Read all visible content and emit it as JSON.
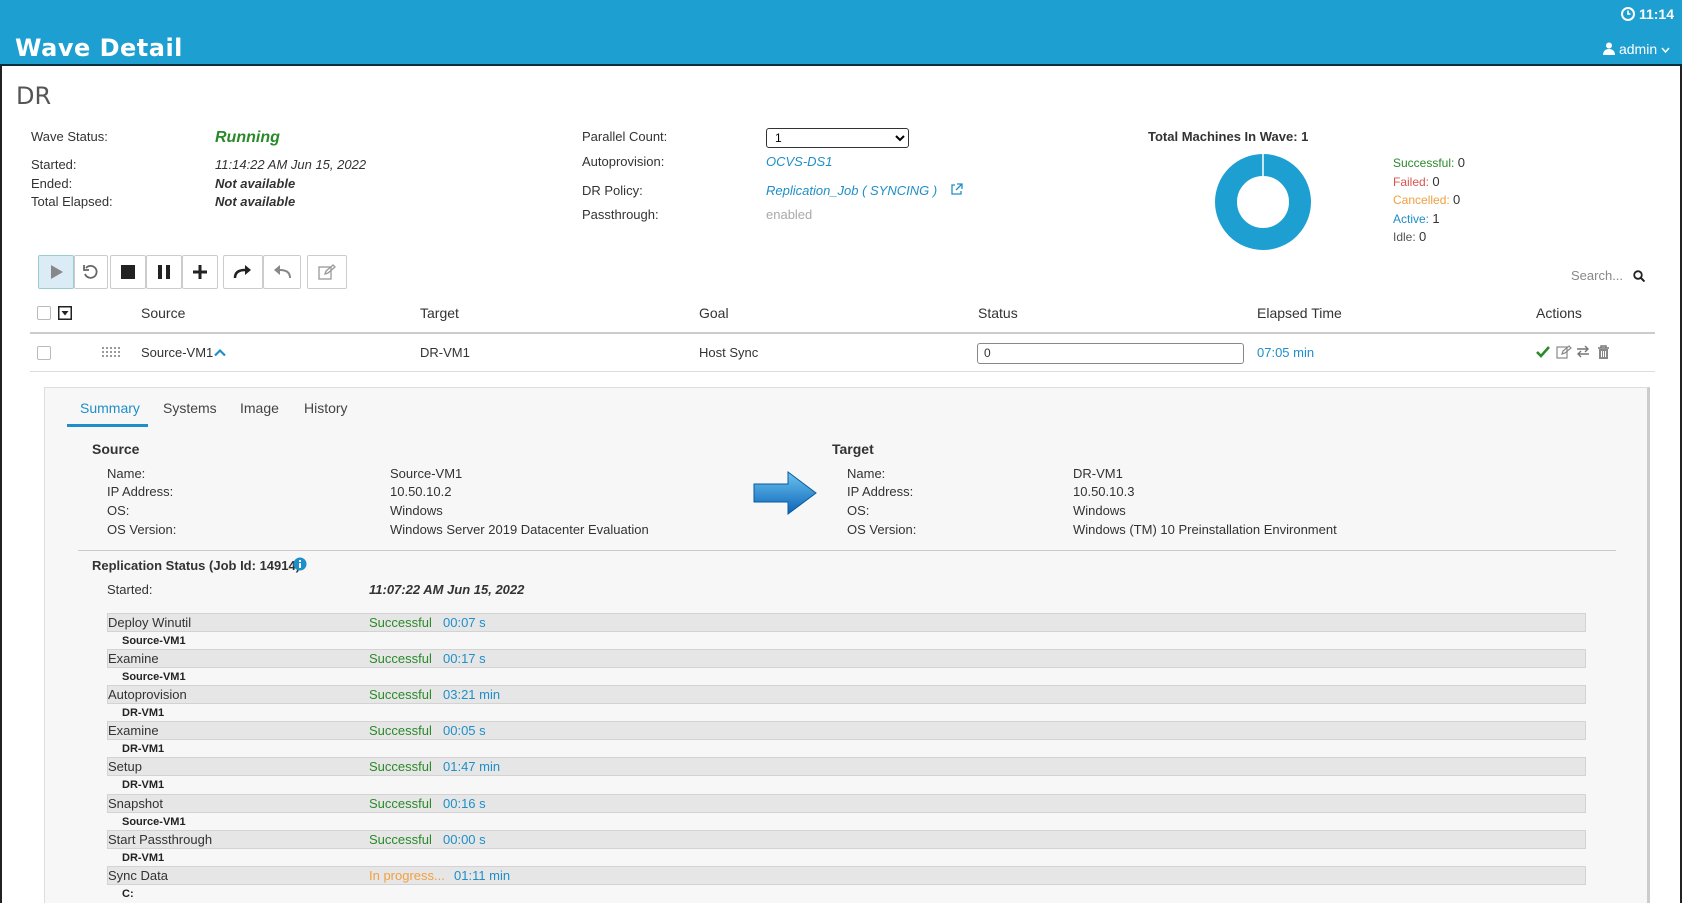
{
  "header": {
    "title": "Wave Detail",
    "clock": "11:14",
    "user": "admin"
  },
  "page_title": "DR",
  "wave": {
    "status_label": "Wave Status:",
    "status_value": "Running",
    "started_label": "Started:",
    "started_value": "11:14:22 AM Jun 15, 2022",
    "ended_label": "Ended:",
    "ended_value": "Not available",
    "elapsed_label": "Total Elapsed:",
    "elapsed_value": "Not available"
  },
  "settings": {
    "parallel_label": "Parallel Count:",
    "parallel_value": "1",
    "autoprov_label": "Autoprovision:",
    "autoprov_value": "OCVS-DS1",
    "policy_label": "DR Policy:",
    "policy_value": "Replication_Job ( SYNCING )",
    "passthrough_label": "Passthrough:",
    "passthrough_value": "enabled"
  },
  "machines": {
    "title": "Total Machines In Wave: 1",
    "legend": [
      {
        "label": "Successful:",
        "value": "0",
        "color": "#2a8a2a"
      },
      {
        "label": "Failed:",
        "value": "0",
        "color": "#d9534f"
      },
      {
        "label": "Cancelled:",
        "value": "0",
        "color": "#f0a040"
      },
      {
        "label": "Active:",
        "value": "1",
        "color": "#1e8fc8"
      },
      {
        "label": "Idle:",
        "value": "0",
        "color": "#555555"
      }
    ],
    "donut_color": "#1e9fd1"
  },
  "search": {
    "placeholder": "Search..."
  },
  "table": {
    "columns": [
      "Source",
      "Target",
      "Goal",
      "Status",
      "Elapsed Time",
      "Actions"
    ],
    "row": {
      "source": "Source-VM1",
      "target": "DR-VM1",
      "goal": "Host Sync",
      "status": "0",
      "elapsed": "07:05 min"
    }
  },
  "detail": {
    "tabs": [
      "Summary",
      "Systems",
      "Image",
      "History"
    ],
    "source": {
      "title": "Source",
      "name_label": "Name:",
      "name": "Source-VM1",
      "ip_label": "IP Address:",
      "ip": "10.50.10.2",
      "os_label": "OS:",
      "os": "Windows",
      "osv_label": "OS Version:",
      "osv": "Windows Server 2019 Datacenter Evaluation"
    },
    "target": {
      "title": "Target",
      "name_label": "Name:",
      "name": "DR-VM1",
      "ip_label": "IP Address:",
      "ip": "10.50.10.3",
      "os_label": "OS:",
      "os": "Windows",
      "osv_label": "OS Version:",
      "osv": "Windows (TM) 10 Preinstallation Environment"
    },
    "replication": {
      "title": "Replication Status (Job Id: 14914)",
      "started_label": "Started:",
      "started_value": "11:07:22 AM Jun 15, 2022",
      "stages": [
        {
          "name": "Deploy Winutil",
          "status": "Successful",
          "time": "00:07 s",
          "host": "Source-VM1"
        },
        {
          "name": "Examine",
          "status": "Successful",
          "time": "00:17 s",
          "host": "Source-VM1"
        },
        {
          "name": "Autoprovision",
          "status": "Successful",
          "time": "03:21 min",
          "host": "DR-VM1"
        },
        {
          "name": "Examine",
          "status": "Successful",
          "time": "00:05 s",
          "host": "DR-VM1"
        },
        {
          "name": "Setup",
          "status": "Successful",
          "time": "01:47 min",
          "host": "DR-VM1"
        },
        {
          "name": "Snapshot",
          "status": "Successful",
          "time": "00:16 s",
          "host": "Source-VM1"
        },
        {
          "name": "Start Passthrough",
          "status": "Successful",
          "time": "00:00 s",
          "host": "DR-VM1"
        },
        {
          "name": "Sync Data",
          "status": "In progress...",
          "time": "01:11 min",
          "host": "C:"
        }
      ]
    }
  }
}
